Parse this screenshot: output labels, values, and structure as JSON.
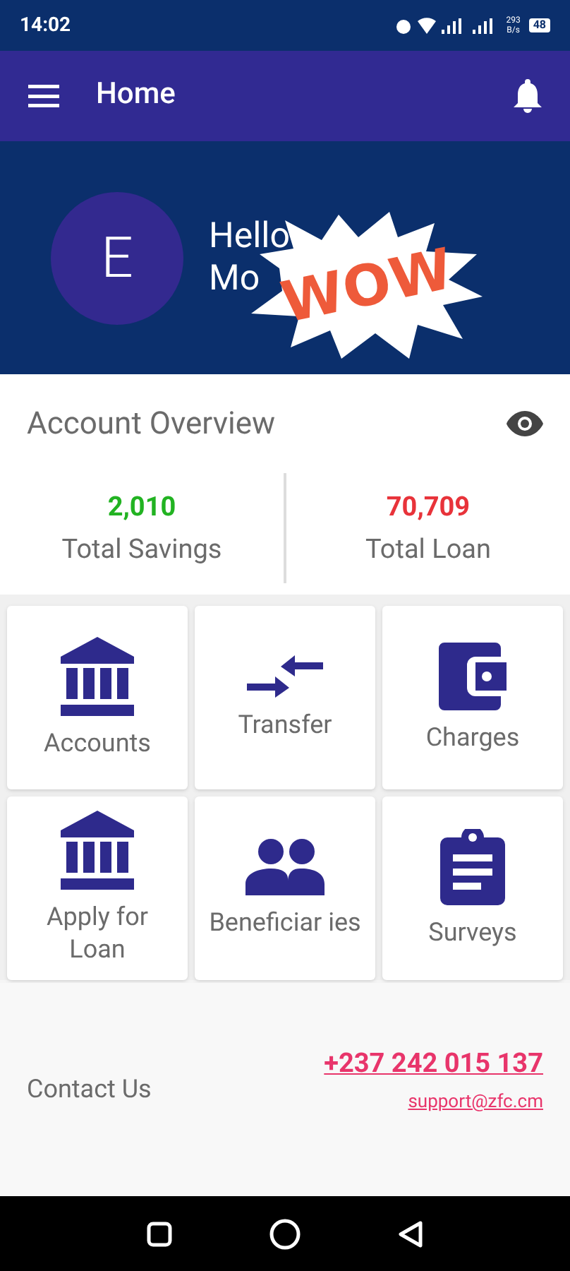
{
  "status_bar": {
    "time": "14:02",
    "speed": "293 B/s",
    "battery": "48"
  },
  "app_bar": {
    "title": "Home"
  },
  "profile": {
    "avatar_letter": "E",
    "greeting_line_1": "Hello",
    "greeting_line_2": "Mo"
  },
  "sticker": {
    "text": "WOW"
  },
  "overview": {
    "title": "Account Overview",
    "stats": [
      {
        "value": "2,010",
        "label": "Total Savings",
        "color": "#22b322"
      },
      {
        "value": "70,709",
        "label": "Total Loan",
        "color": "#e8333a"
      }
    ]
  },
  "menu": [
    {
      "kind": "bank",
      "label": "Accounts"
    },
    {
      "kind": "transfer",
      "label": "Transfer"
    },
    {
      "kind": "wallet",
      "label": "Charges"
    },
    {
      "kind": "bank",
      "label": "Apply for Loan"
    },
    {
      "kind": "people",
      "label": "Beneficiar ies"
    },
    {
      "kind": "clipboard",
      "label": "Surveys"
    }
  ],
  "contact": {
    "label": "Contact Us",
    "phone": "+237 242 015 137",
    "email": "support@zfc.cm"
  }
}
